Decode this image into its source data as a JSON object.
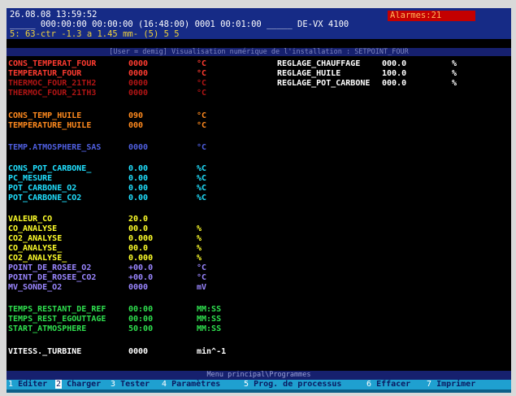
{
  "header": {
    "line1": "26.08.08 13:59:52",
    "line2": "_____ 000:00:00 00:00:00 (16:48:00) 0001 00:01:00 _____ DE-VX 4100",
    "line3": "5: 63-ctr -1.3 a 1.45 mm- (5) 5 5",
    "alarm": "Alarmes:21"
  },
  "banner": "[User = demig] Visualisation numérique de l'installation : SETPOINT_FOUR",
  "colors": {
    "red": "#ff3b30",
    "dark_red": "#b01414",
    "orange": "#ff8a1e",
    "blue": "#4f5fe0",
    "cyan": "#20e0ff",
    "yellow": "#ffff2a",
    "violet": "#9a86ff",
    "green": "#2fe04f",
    "white": "#ffffff",
    "header_text": "#ffffff",
    "header_sub": "#f0d23c"
  },
  "rows": [
    {
      "label": "CONS_TEMPERAT_FOUR",
      "value": "0000",
      "unit": "°C",
      "color": "#ff3b30"
    },
    {
      "label": "TEMPERATUR_FOUR",
      "value": "0000",
      "unit": "°C",
      "color": "#ff3b30"
    },
    {
      "label": "THERMOC_FOUR_21TH2",
      "value": "0000",
      "unit": "°C",
      "color": "#b01414"
    },
    {
      "label": "THERMOC_FOUR_21TH3",
      "value": "0000",
      "unit": "°C",
      "color": "#b01414"
    },
    {
      "label": "CONS_TEMP_HUILE",
      "value": "090",
      "unit": "°C",
      "color": "#ff8a1e"
    },
    {
      "label": "TEMPERATURE_HUILE",
      "value": "000",
      "unit": "°C",
      "color": "#ff8a1e"
    },
    {
      "label": "TEMP.ATMOSPHERE_SAS",
      "value": "0000",
      "unit": "°C",
      "color": "#4f5fe0"
    },
    {
      "label": "CONS_POT_CARBONE_",
      "value": "0.00",
      "unit": "%C",
      "color": "#20e0ff"
    },
    {
      "label": "PC_MESURE",
      "value": "0.00",
      "unit": "%C",
      "color": "#20e0ff"
    },
    {
      "label": "POT_CARBONE_O2",
      "value": "0.00",
      "unit": "%C",
      "color": "#20e0ff"
    },
    {
      "label": "POT_CARBONE_CO2",
      "value": "0.00",
      "unit": "%C",
      "color": "#20e0ff"
    },
    {
      "label": "VALEUR_CO",
      "value": "20.0",
      "unit": "",
      "color": "#ffff2a"
    },
    {
      "label": "CO_ANALYSE",
      "value": "00.0",
      "unit": "%",
      "color": "#ffff2a"
    },
    {
      "label": "CO2_ANALYSE",
      "value": "0.000",
      "unit": "%",
      "color": "#ffff2a"
    },
    {
      "label": "CO_ANALYSE_",
      "value": "00.0",
      "unit": "%",
      "color": "#ffff2a"
    },
    {
      "label": "CO2_ANALYSE_",
      "value": "0.000",
      "unit": "%",
      "color": "#ffff2a"
    },
    {
      "label": "POINT_DE_ROSEE_O2",
      "value": "+00.0",
      "unit": "°C",
      "color": "#9a86ff"
    },
    {
      "label": "POINT_DE_ROSEE_CO2",
      "value": "+00.0",
      "unit": "°C",
      "color": "#9a86ff"
    },
    {
      "label": "MV_SONDE_O2",
      "value": "0000",
      "unit": "mV",
      "color": "#9a86ff"
    },
    {
      "label": "TEMPS_RESTANT_DE_REF",
      "value": "00:00",
      "unit": "MM:SS",
      "color": "#2fe04f"
    },
    {
      "label": "TEMPS_REST_EGOUTTAGE",
      "value": "00:00",
      "unit": "MM:SS",
      "color": "#2fe04f"
    },
    {
      "label": "START_ATMOSPHERE",
      "value": "50:00",
      "unit": "MM:SS",
      "color": "#2fe04f"
    },
    {
      "label": "VITESS._TURBINE",
      "value": "0000",
      "unit": "min^-1",
      "color": "#ffffff"
    }
  ],
  "right_rows": [
    {
      "label": "REGLAGE_CHAUFFAGE",
      "value": "000.0",
      "unit": "%"
    },
    {
      "label": "REGLAGE_HUILE",
      "value": "100.0",
      "unit": "%"
    },
    {
      "label": "REGLAGE_POT_CARBONE",
      "value": "000.0",
      "unit": "%"
    }
  ],
  "menu": {
    "title": "Menu principal\\Programmes",
    "items": [
      {
        "num": "1",
        "label": "Editer"
      },
      {
        "num": "2",
        "label": "Charger"
      },
      {
        "num": "3",
        "label": "Tester"
      },
      {
        "num": "4",
        "label": "Paramètres"
      },
      {
        "num": "5",
        "label": "Prog. de processus"
      },
      {
        "num": "6",
        "label": "Effacer"
      },
      {
        "num": "7",
        "label": "Imprimer"
      }
    ]
  }
}
